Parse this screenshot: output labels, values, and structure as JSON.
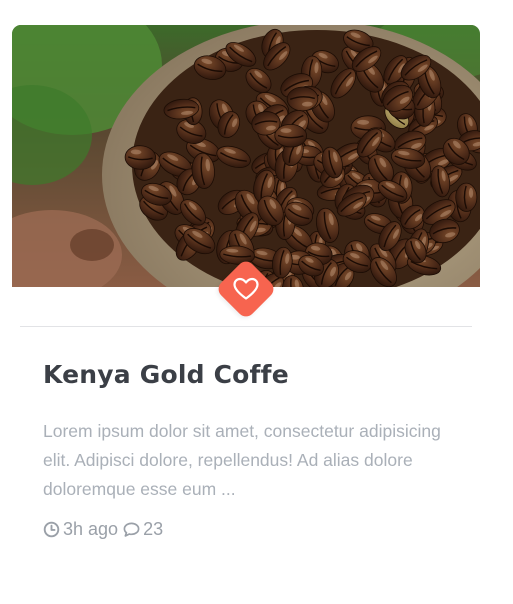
{
  "card": {
    "title": "Kenya Gold Coffe",
    "excerpt": "Lorem ipsum dolor sit amet, consectetur adipisicing elit. Adipisci dolore, repellendus! Ad alias dolore doloremque esse eum ...",
    "image_subject": "coffee beans in a burlap sack",
    "favorite_icon": "heart-icon",
    "meta": {
      "time_icon": "clock-icon",
      "time": "3h ago",
      "comments_icon": "comment-icon",
      "comments": "23"
    }
  },
  "colors": {
    "accent": "#f7644f",
    "title": "#3b3f46",
    "excerpt": "#aab0b8",
    "meta": "#9aa0a8",
    "divider": "#e2e3e6"
  }
}
